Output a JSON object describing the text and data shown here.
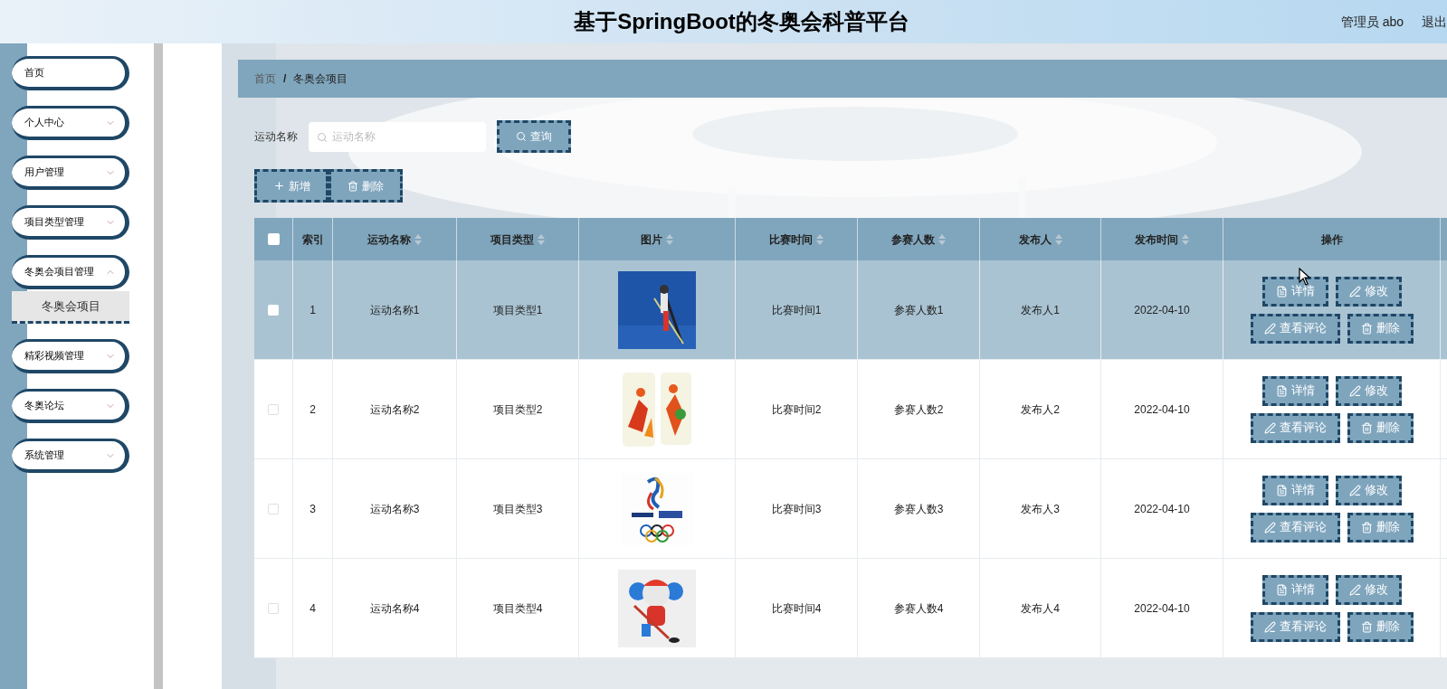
{
  "header": {
    "title": "基于SpringBoot的冬奥会科普平台",
    "user": "管理员 abo",
    "logout": "退出"
  },
  "sidebar": {
    "items": [
      {
        "label": "首页",
        "has_children": false
      },
      {
        "label": "个人中心",
        "has_children": true,
        "expanded": false
      },
      {
        "label": "用户管理",
        "has_children": true,
        "expanded": false
      },
      {
        "label": "项目类型管理",
        "has_children": true,
        "expanded": false
      },
      {
        "label": "冬奥会项目管理",
        "has_children": true,
        "expanded": true,
        "children": [
          {
            "label": "冬奥会项目",
            "selected": true
          }
        ]
      },
      {
        "label": "精彩视频管理",
        "has_children": true,
        "expanded": false
      },
      {
        "label": "冬奥论坛",
        "has_children": true,
        "expanded": false
      },
      {
        "label": "系统管理",
        "has_children": true,
        "expanded": false
      }
    ]
  },
  "breadcrumb": {
    "separator": "/",
    "items": [
      "首页",
      "冬奥会项目"
    ]
  },
  "search": {
    "label": "运动名称",
    "placeholder": "运动名称",
    "button": "查询"
  },
  "toolbar": [
    "新增",
    "删除"
  ],
  "table": {
    "select_all_checked": false,
    "columns": [
      {
        "label": "索引",
        "sortable": false
      },
      {
        "label": "运动名称",
        "sortable": true
      },
      {
        "label": "项目类型",
        "sortable": true
      },
      {
        "label": "图片",
        "sortable": true
      },
      {
        "label": "比赛时间",
        "sortable": true
      },
      {
        "label": "参赛人数",
        "sortable": true
      },
      {
        "label": "发布人",
        "sortable": true
      },
      {
        "label": "发布时间",
        "sortable": true
      },
      {
        "label": "操作",
        "sortable": false
      }
    ],
    "rows": [
      {
        "selected": true,
        "checked": false,
        "index": "1",
        "name": "运动名称1",
        "type": "项目类型1",
        "time": "比赛时间1",
        "count": "参赛人数1",
        "publisher": "发布人1",
        "date": "2022-04-10",
        "actions": [
          "详情",
          "修改",
          "查看评论",
          "删除"
        ]
      },
      {
        "selected": false,
        "checked": false,
        "index": "2",
        "name": "运动名称2",
        "type": "项目类型2",
        "time": "比赛时间2",
        "count": "参赛人数2",
        "publisher": "发布人2",
        "date": "2022-04-10",
        "actions": [
          "详情",
          "修改",
          "查看评论",
          "删除"
        ]
      },
      {
        "selected": false,
        "checked": false,
        "index": "3",
        "name": "运动名称3",
        "type": "项目类型3",
        "time": "比赛时间3",
        "count": "参赛人数3",
        "publisher": "发布人3",
        "date": "2022-04-10",
        "actions": [
          "详情",
          "修改",
          "查看评论",
          "删除"
        ]
      },
      {
        "selected": false,
        "checked": false,
        "index": "4",
        "name": "运动名称4",
        "type": "项目类型4",
        "time": "比赛时间4",
        "count": "参赛人数4",
        "publisher": "发布人4",
        "date": "2022-04-10",
        "actions": [
          "详情",
          "修改",
          "查看评论",
          "删除"
        ]
      }
    ]
  }
}
